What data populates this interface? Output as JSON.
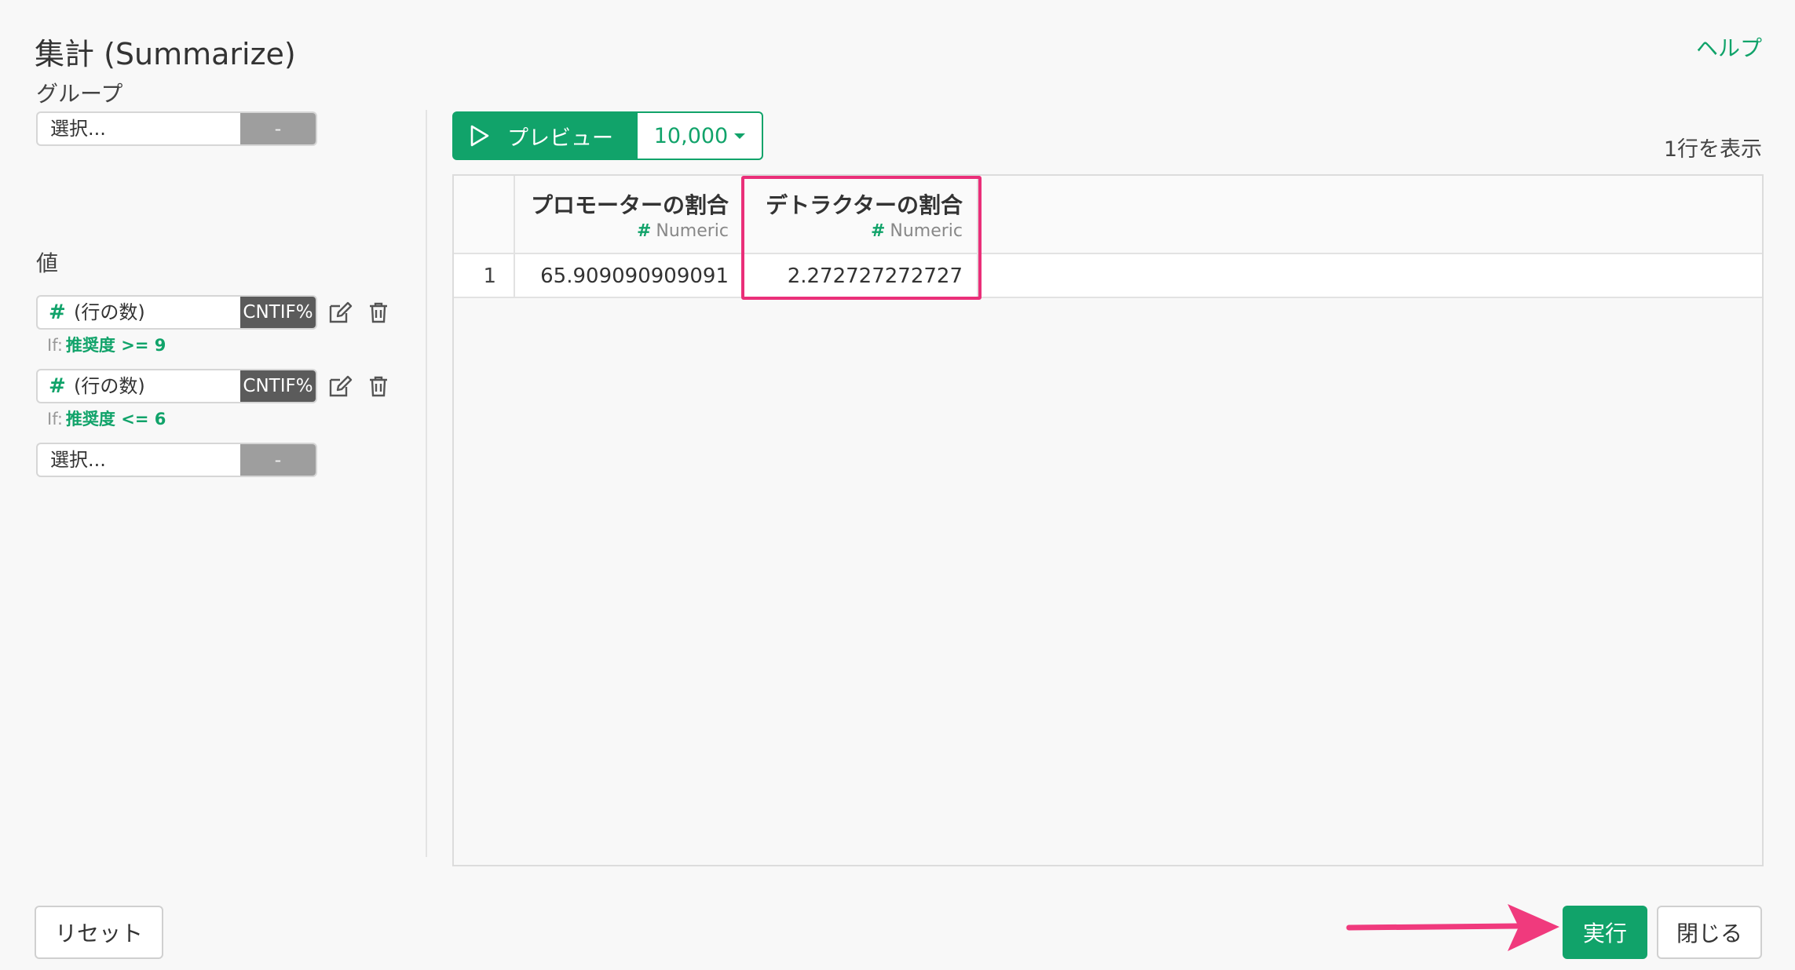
{
  "header": {
    "title": "集計 (Summarize)",
    "help_label": "ヘルプ"
  },
  "group": {
    "label": "グループ",
    "selector_placeholder": "選択...",
    "selector_button": "-"
  },
  "values": {
    "label": "値",
    "items": [
      {
        "hash": "#",
        "name": "(行の数)",
        "func": "CNTIF%",
        "if_prefix": "If:",
        "condition": "推奨度 >= 9"
      },
      {
        "hash": "#",
        "name": "(行の数)",
        "func": "CNTIF%",
        "if_prefix": "If:",
        "condition": "推奨度 <= 6"
      }
    ],
    "selector_placeholder": "選択...",
    "selector_button": "-"
  },
  "toolbar": {
    "preview_label": "プレビュー",
    "rows_value": "10,000",
    "row_count_text": "1行を表示"
  },
  "table": {
    "columns": [
      {
        "title": "プロモーターの割合",
        "type": "Numeric",
        "type_hash": "#"
      },
      {
        "title": "デトラクターの割合",
        "type": "Numeric",
        "type_hash": "#"
      }
    ],
    "rows": [
      {
        "index": "1",
        "cells": [
          "65.909090909091",
          "2.272727272727"
        ]
      }
    ]
  },
  "footer": {
    "reset_label": "リセット",
    "run_label": "実行",
    "close_label": "閉じる"
  },
  "colors": {
    "accent": "#11a36a",
    "highlight": "#ea2f79"
  }
}
